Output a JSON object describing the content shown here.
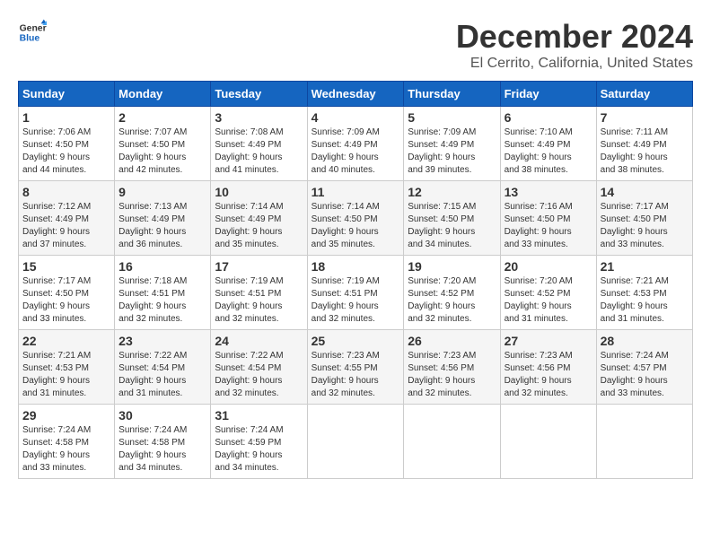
{
  "logo": {
    "line1": "General",
    "line2": "Blue"
  },
  "title": "December 2024",
  "subtitle": "El Cerrito, California, United States",
  "headers": [
    "Sunday",
    "Monday",
    "Tuesday",
    "Wednesday",
    "Thursday",
    "Friday",
    "Saturday"
  ],
  "weeks": [
    [
      {
        "day": "1",
        "info": "Sunrise: 7:06 AM\nSunset: 4:50 PM\nDaylight: 9 hours\nand 44 minutes."
      },
      {
        "day": "2",
        "info": "Sunrise: 7:07 AM\nSunset: 4:50 PM\nDaylight: 9 hours\nand 42 minutes."
      },
      {
        "day": "3",
        "info": "Sunrise: 7:08 AM\nSunset: 4:49 PM\nDaylight: 9 hours\nand 41 minutes."
      },
      {
        "day": "4",
        "info": "Sunrise: 7:09 AM\nSunset: 4:49 PM\nDaylight: 9 hours\nand 40 minutes."
      },
      {
        "day": "5",
        "info": "Sunrise: 7:09 AM\nSunset: 4:49 PM\nDaylight: 9 hours\nand 39 minutes."
      },
      {
        "day": "6",
        "info": "Sunrise: 7:10 AM\nSunset: 4:49 PM\nDaylight: 9 hours\nand 38 minutes."
      },
      {
        "day": "7",
        "info": "Sunrise: 7:11 AM\nSunset: 4:49 PM\nDaylight: 9 hours\nand 38 minutes."
      }
    ],
    [
      {
        "day": "8",
        "info": "Sunrise: 7:12 AM\nSunset: 4:49 PM\nDaylight: 9 hours\nand 37 minutes."
      },
      {
        "day": "9",
        "info": "Sunrise: 7:13 AM\nSunset: 4:49 PM\nDaylight: 9 hours\nand 36 minutes."
      },
      {
        "day": "10",
        "info": "Sunrise: 7:14 AM\nSunset: 4:49 PM\nDaylight: 9 hours\nand 35 minutes."
      },
      {
        "day": "11",
        "info": "Sunrise: 7:14 AM\nSunset: 4:50 PM\nDaylight: 9 hours\nand 35 minutes."
      },
      {
        "day": "12",
        "info": "Sunrise: 7:15 AM\nSunset: 4:50 PM\nDaylight: 9 hours\nand 34 minutes."
      },
      {
        "day": "13",
        "info": "Sunrise: 7:16 AM\nSunset: 4:50 PM\nDaylight: 9 hours\nand 33 minutes."
      },
      {
        "day": "14",
        "info": "Sunrise: 7:17 AM\nSunset: 4:50 PM\nDaylight: 9 hours\nand 33 minutes."
      }
    ],
    [
      {
        "day": "15",
        "info": "Sunrise: 7:17 AM\nSunset: 4:50 PM\nDaylight: 9 hours\nand 33 minutes."
      },
      {
        "day": "16",
        "info": "Sunrise: 7:18 AM\nSunset: 4:51 PM\nDaylight: 9 hours\nand 32 minutes."
      },
      {
        "day": "17",
        "info": "Sunrise: 7:19 AM\nSunset: 4:51 PM\nDaylight: 9 hours\nand 32 minutes."
      },
      {
        "day": "18",
        "info": "Sunrise: 7:19 AM\nSunset: 4:51 PM\nDaylight: 9 hours\nand 32 minutes."
      },
      {
        "day": "19",
        "info": "Sunrise: 7:20 AM\nSunset: 4:52 PM\nDaylight: 9 hours\nand 32 minutes."
      },
      {
        "day": "20",
        "info": "Sunrise: 7:20 AM\nSunset: 4:52 PM\nDaylight: 9 hours\nand 31 minutes."
      },
      {
        "day": "21",
        "info": "Sunrise: 7:21 AM\nSunset: 4:53 PM\nDaylight: 9 hours\nand 31 minutes."
      }
    ],
    [
      {
        "day": "22",
        "info": "Sunrise: 7:21 AM\nSunset: 4:53 PM\nDaylight: 9 hours\nand 31 minutes."
      },
      {
        "day": "23",
        "info": "Sunrise: 7:22 AM\nSunset: 4:54 PM\nDaylight: 9 hours\nand 31 minutes."
      },
      {
        "day": "24",
        "info": "Sunrise: 7:22 AM\nSunset: 4:54 PM\nDaylight: 9 hours\nand 32 minutes."
      },
      {
        "day": "25",
        "info": "Sunrise: 7:23 AM\nSunset: 4:55 PM\nDaylight: 9 hours\nand 32 minutes."
      },
      {
        "day": "26",
        "info": "Sunrise: 7:23 AM\nSunset: 4:56 PM\nDaylight: 9 hours\nand 32 minutes."
      },
      {
        "day": "27",
        "info": "Sunrise: 7:23 AM\nSunset: 4:56 PM\nDaylight: 9 hours\nand 32 minutes."
      },
      {
        "day": "28",
        "info": "Sunrise: 7:24 AM\nSunset: 4:57 PM\nDaylight: 9 hours\nand 33 minutes."
      }
    ],
    [
      {
        "day": "29",
        "info": "Sunrise: 7:24 AM\nSunset: 4:58 PM\nDaylight: 9 hours\nand 33 minutes."
      },
      {
        "day": "30",
        "info": "Sunrise: 7:24 AM\nSunset: 4:58 PM\nDaylight: 9 hours\nand 34 minutes."
      },
      {
        "day": "31",
        "info": "Sunrise: 7:24 AM\nSunset: 4:59 PM\nDaylight: 9 hours\nand 34 minutes."
      },
      null,
      null,
      null,
      null
    ]
  ]
}
